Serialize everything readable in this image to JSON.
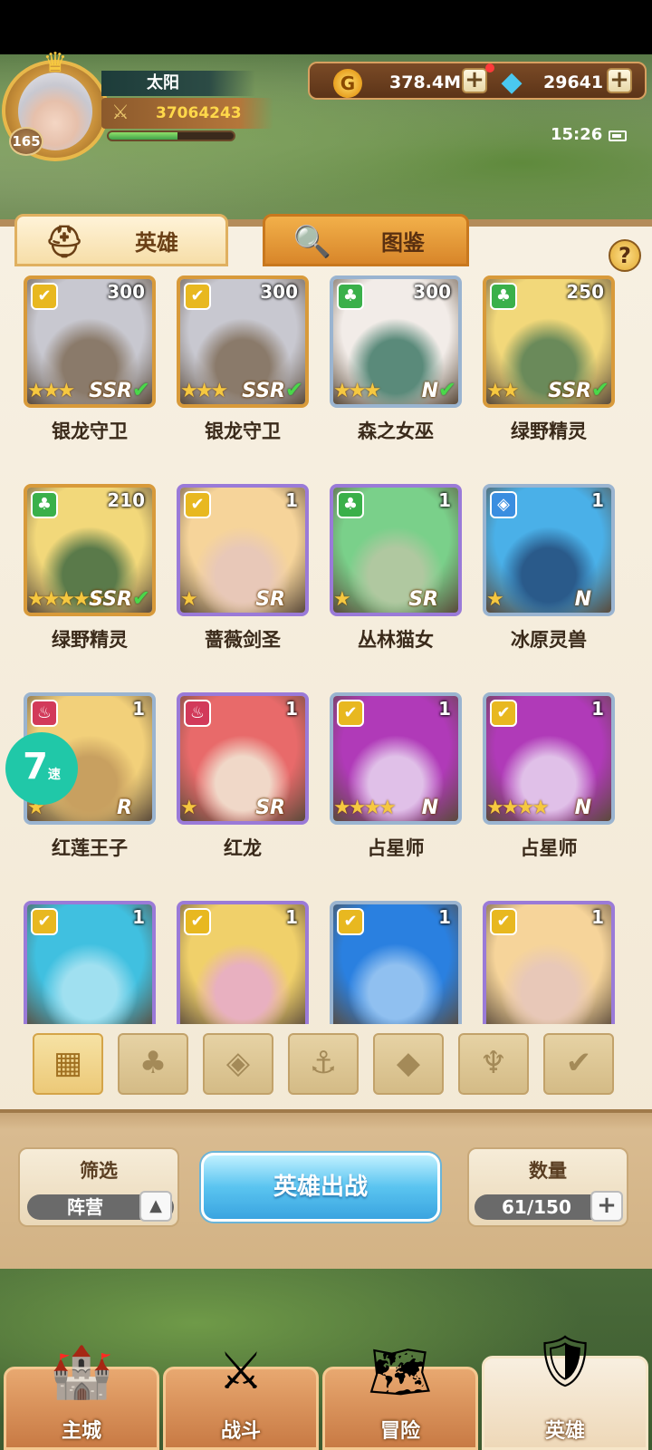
{
  "player": {
    "name": "太阳",
    "level": "165",
    "power": "37064243",
    "exp_fraction": 0.55
  },
  "currency": {
    "gold": "378.4M",
    "gems": "29641",
    "gold_symbol": "G",
    "plus": "+"
  },
  "status": {
    "time": "15:26"
  },
  "tabs": {
    "heroes": "英雄",
    "dex": "图鉴"
  },
  "help": "?",
  "heroes": [
    {
      "name": "银龙守卫",
      "count": "300",
      "faction": "light",
      "stars": "★★★",
      "rarity": "SSR",
      "check": "✔"
    },
    {
      "name": "银龙守卫",
      "count": "300",
      "faction": "light",
      "stars": "★★★",
      "rarity": "SSR",
      "check": "✔"
    },
    {
      "name": "森之女巫",
      "count": "300",
      "faction": "forest",
      "stars": "★★★",
      "rarity": "N",
      "check": "✔"
    },
    {
      "name": "绿野精灵",
      "count": "250",
      "faction": "forest",
      "stars": "★★",
      "rarity": "SSR",
      "check": "✔"
    },
    {
      "name": "绿野精灵",
      "count": "210",
      "faction": "forest",
      "stars": "★★★★★",
      "rarity": "SSR",
      "check": "✔"
    },
    {
      "name": "蔷薇剑圣",
      "count": "1",
      "faction": "light",
      "stars": "★",
      "rarity": "SR",
      "check": ""
    },
    {
      "name": "丛林猫女",
      "count": "1",
      "faction": "forest",
      "stars": "★",
      "rarity": "SR",
      "check": ""
    },
    {
      "name": "冰原灵兽",
      "count": "1",
      "faction": "water",
      "stars": "★",
      "rarity": "N",
      "check": ""
    },
    {
      "name": "红莲王子",
      "count": "1",
      "faction": "fire",
      "stars": "★",
      "rarity": "R",
      "check": ""
    },
    {
      "name": "红龙",
      "count": "1",
      "faction": "fire",
      "stars": "★",
      "rarity": "SR",
      "check": ""
    },
    {
      "name": "占星师",
      "count": "1",
      "faction": "light",
      "stars": "★★★★",
      "rarity": "N",
      "check": ""
    },
    {
      "name": "占星师",
      "count": "1",
      "faction": "light",
      "stars": "★★★★",
      "rarity": "N",
      "check": ""
    },
    {
      "name": "",
      "count": "1",
      "faction": "light",
      "stars": "",
      "rarity": "",
      "check": ""
    },
    {
      "name": "",
      "count": "1",
      "faction": "light",
      "stars": "",
      "rarity": "",
      "check": ""
    },
    {
      "name": "",
      "count": "1",
      "faction": "light",
      "stars": "",
      "rarity": "",
      "check": ""
    },
    {
      "name": "",
      "count": "1",
      "faction": "light",
      "stars": "",
      "rarity": "",
      "check": ""
    }
  ],
  "speed_badge": {
    "number": "7",
    "label": "速"
  },
  "filter": {
    "title": "筛选",
    "value": "阵营",
    "arrow": "▲"
  },
  "deploy_button": "英雄出战",
  "hero_count": {
    "title": "数量",
    "value": "61/150",
    "plus": "+"
  },
  "nav": [
    {
      "label": "主城",
      "icon": "city-icon"
    },
    {
      "label": "战斗",
      "icon": "crossed-swords-icon"
    },
    {
      "label": "冒险",
      "icon": "map-icon"
    },
    {
      "label": "英雄",
      "icon": "hero-crest-icon"
    }
  ],
  "colors": {
    "light_faction": "#e8b820",
    "forest_faction": "#3ab04a",
    "water_faction": "#3a8ee0",
    "fire_faction": "#d23a5a",
    "deploy_button": "#5ac4f0"
  }
}
